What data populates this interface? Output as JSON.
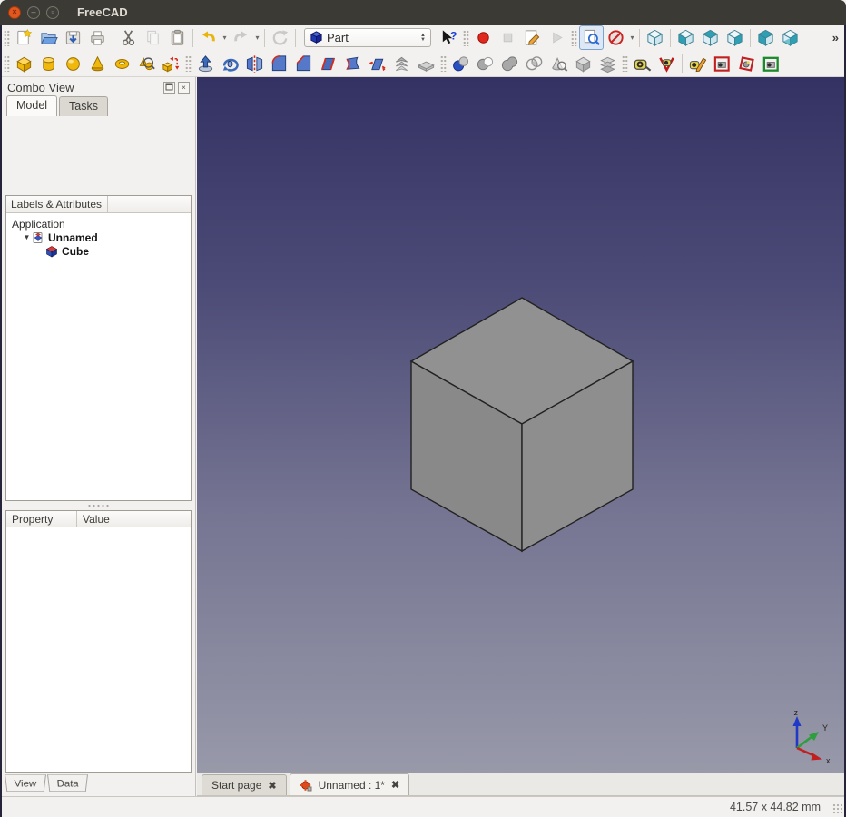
{
  "window": {
    "title": "FreeCAD"
  },
  "titlebar": {
    "buttons": [
      "close",
      "minimize",
      "maximize"
    ]
  },
  "toolbar_standard": {
    "workbench_selector": {
      "value": "Part"
    },
    "overflow_label": "»",
    "icons": [
      "new-document",
      "open-document",
      "save-document",
      "print",
      "cut",
      "copy",
      "paste",
      "undo",
      "redo",
      "refresh",
      "workbench-selector",
      "whats-this",
      "macro-record",
      "macro-stop",
      "macro-edit",
      "macro-play",
      "fit-all",
      "draw-style",
      "axonometric-view",
      "front-view",
      "top-view",
      "right-view",
      "rear-view",
      "bottom-view",
      "toolbar-overflow"
    ]
  },
  "toolbar_part": {
    "icons": [
      "box",
      "cylinder",
      "sphere",
      "cone",
      "torus",
      "create-primitives",
      "shape-builder",
      "extrude",
      "revolve",
      "mirror",
      "fillet",
      "chamfer",
      "make-face",
      "ruled-surface",
      "loft",
      "sweep",
      "cross-section",
      "boolean",
      "boolean-cut",
      "boolean-union",
      "boolean-intersection",
      "check-geometry",
      "defeaturing",
      "cross-sections",
      "measure-linear",
      "measure-angular",
      "measure-refresh",
      "toggle-all-measurements",
      "toggle-3d-measurements",
      "toggle-delta-measurements"
    ]
  },
  "combo_view": {
    "title": "Combo View",
    "close_glyph": "×",
    "tabs": [
      {
        "label": "Model",
        "active": true
      },
      {
        "label": "Tasks",
        "active": false
      }
    ],
    "tree_header": "Labels & Attributes",
    "tree": {
      "root_label": "Application",
      "document_label": "Unnamed",
      "items": [
        {
          "label": "Cube"
        }
      ]
    },
    "property_table": {
      "columns": [
        "Property",
        "Value"
      ],
      "rows": []
    },
    "bottom_tabs": [
      {
        "label": "View"
      },
      {
        "label": "Data"
      }
    ]
  },
  "viewport": {
    "object": "Cube",
    "background_top": "#343263",
    "background_bottom": "#9899a9",
    "cube_face_color": "#8b8b8b",
    "axis_labels": {
      "x": "x",
      "y": "Y",
      "z": "z"
    }
  },
  "document_tabs": [
    {
      "label": "Start page",
      "active": false,
      "close_glyph": "✖"
    },
    {
      "label": "Unnamed : 1*",
      "active": true,
      "close_glyph": "✖"
    }
  ],
  "status_bar": {
    "dimensions": "41.57 x 44.82 mm"
  },
  "colors": {
    "titlebar": "#3b3a35",
    "close_button": "#e2561f",
    "toolbar_bg": "#f2f1ef",
    "primitive_yellow": "#f0b80d",
    "tool_blue": "#3a6ab8",
    "record_red": "#e0281e",
    "view_teal": "#2fa0b3"
  }
}
